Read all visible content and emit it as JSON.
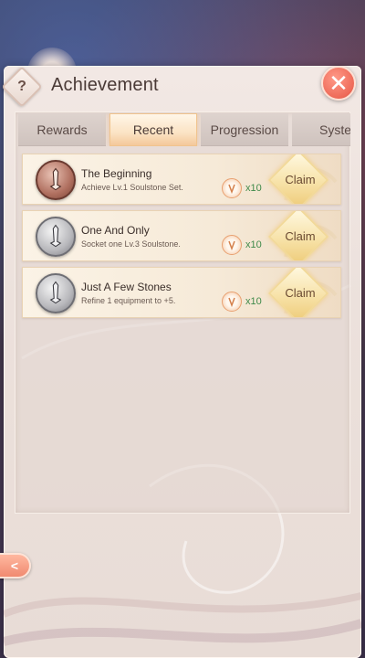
{
  "header": {
    "title": "Achievement",
    "help_label": "?",
    "close_label": "✕"
  },
  "tabs": [
    {
      "label": "Rewards",
      "active": false
    },
    {
      "label": "Recent",
      "active": true
    },
    {
      "label": "Progression",
      "active": false
    },
    {
      "label": "System",
      "active": false
    }
  ],
  "achievements": [
    {
      "title": "The Beginning",
      "description": "Achieve Lv.1 Soulstone Set.",
      "reward_qty": "x10",
      "button": "Claim",
      "medal": "bronze"
    },
    {
      "title": "One And Only",
      "description": "Socket one Lv.3 Soulstone.",
      "reward_qty": "x10",
      "button": "Claim",
      "medal": "silver"
    },
    {
      "title": "Just A Few Stones",
      "description": "Refine 1 equipment to +5.",
      "reward_qty": "x10",
      "button": "Claim",
      "medal": "silver"
    }
  ],
  "back_label": "<",
  "colors": {
    "accent_close": "#ee6a58",
    "reward_qty": "#3f8a4a",
    "tab_active": "#fbe3c4",
    "claim": "#f7e2a8"
  },
  "icons": {
    "medal": "sword-medal-icon",
    "reward": "reward-token-icon",
    "close": "close-icon",
    "back": "back-arrow-icon",
    "help": "help-icon"
  }
}
